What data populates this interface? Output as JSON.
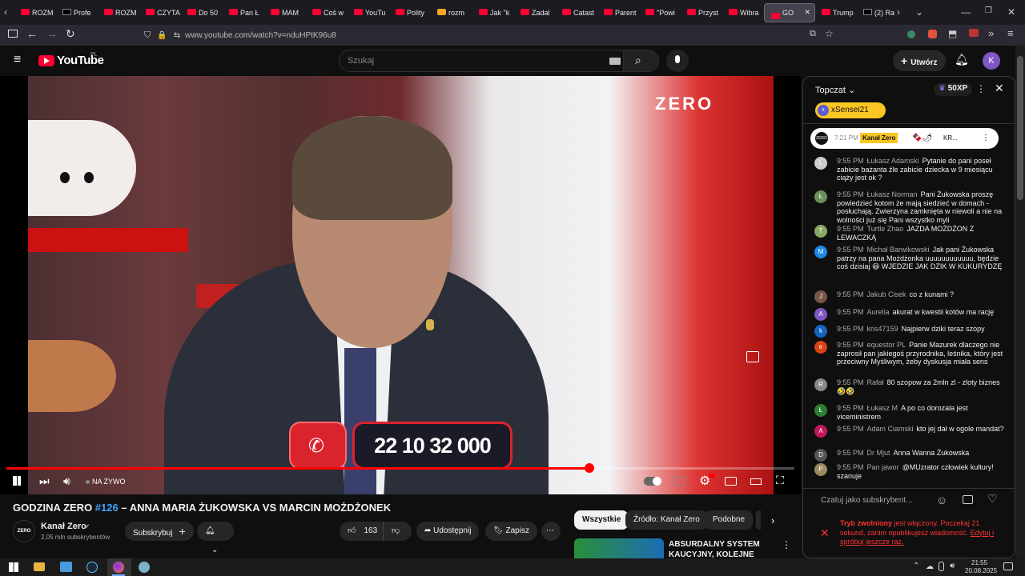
{
  "browser": {
    "tabs": [
      {
        "label": "ROZM",
        "fav": "yt"
      },
      {
        "label": "Profe",
        "fav": "x"
      },
      {
        "label": "ROZM",
        "fav": "yt"
      },
      {
        "label": "CZYTA",
        "fav": "yt"
      },
      {
        "label": "Do 50",
        "fav": "yt"
      },
      {
        "label": "Pan Ł",
        "fav": "yt"
      },
      {
        "label": "MAM",
        "fav": "yt"
      },
      {
        "label": "Coś w",
        "fav": "yt"
      },
      {
        "label": "YouTu",
        "fav": "yt"
      },
      {
        "label": "Polity",
        "fav": "yt"
      },
      {
        "label": "rozm",
        "fav": "jp"
      },
      {
        "label": "Jak \"k",
        "fav": "yt"
      },
      {
        "label": "Zadal",
        "fav": "yt"
      },
      {
        "label": "Catast",
        "fav": "yt"
      },
      {
        "label": "Parent",
        "fav": "yt"
      },
      {
        "label": "\"Powi",
        "fav": "yt"
      },
      {
        "label": "Przyst",
        "fav": "yt"
      },
      {
        "label": "Wibra",
        "fav": "yt"
      },
      {
        "label": "GO",
        "fav": "yt",
        "active": true
      },
      {
        "label": "Trump",
        "fav": "yt"
      },
      {
        "label": "(2) Ra",
        "fav": "x"
      }
    ],
    "url": "www.youtube.com/watch?v=nduHPtK96u8"
  },
  "youtube": {
    "logo": "YouTube",
    "region": "PL",
    "search_placeholder": "Szukaj",
    "create_label": "Utwórz",
    "avatar_letter": "K"
  },
  "video": {
    "live_label": "NA ŻYWO",
    "phone_number": "22 10 32 000",
    "channel_watermark": "ZERO",
    "progress_fraction": 0.74
  },
  "meta": {
    "title_prefix": "GODZINA ZERO ",
    "title_episode": "#126",
    "title_rest": " – ANNA MARIA ŻUKOWSKA VS MARCIN MOŻDŻONEK",
    "channel_name": "Kanał Zero",
    "subscribers": "2,05 mln subskrybentów",
    "subscribe_label": "Subskrybuj",
    "likes": "163",
    "share_label": "Udostępnij",
    "save_label": "Zapisz"
  },
  "chips": [
    "Wszystkie",
    "Źródło: Kanał Zero",
    "Podobne"
  ],
  "recommendation": {
    "title_line1": "ABSURDALNY SYSTEM",
    "title_line2": "KAUCYJNY, KOLEJNE"
  },
  "chat": {
    "header": "Topczat",
    "xp": "50XP",
    "pinned_user": "xSensei21",
    "pinned_msg_time": "7:21 PM",
    "pinned_msg_author": "Kanał Zero",
    "pinned_msg_text": "KR...",
    "input_placeholder": "Czatuj jako subskrybent...",
    "slow_mode_title": "Tryb zwolniony",
    "slow_mode_text": " jest włączony. Poczekaj 21 sekund, zanim opublikujesz wiadomość.",
    "slow_mode_link": "Edytuj i spróbuj jeszcze raz.",
    "messages": [
      {
        "time": "9:55 PM",
        "author": "Łukasz Adamski",
        "text": "Pytanie do pani poseł zabicie bażanta źle zabicie dziecka w 9 miesiącu ciąży jest ok ?",
        "av": "L",
        "color": "#ccc"
      },
      {
        "time": "9:55 PM",
        "author": "Łukasz Norman",
        "text": "Pani Żukowska proszę powiedzieć kotom że mają siedzieć w domach - posłuchają. Zwierzyna zamknięta w niewoli a nie na wolności już się Pani wszystko myli",
        "av": "Ł",
        "color": "#6b8f5a"
      },
      {
        "time": "9:55 PM",
        "author": "Turtle Zhao",
        "text": "JAZDA MOŻDŻON Z LEWACZKĄ",
        "av": "T",
        "color": "#8a6"
      },
      {
        "time": "9:55 PM",
        "author": "Michał Barwikowski",
        "text": "Jak pani Żukowska patrzy na pana Możdżonka uuuuuuuuuuuu, będzie coś dzisiaj 😆 WJEDZIE JAK DZIK W KUKURYDZĘ",
        "av": "M",
        "color": "#1e88e5"
      },
      {
        "time": "9:55 PM",
        "author": "Jakub Cisek",
        "text": "co z kunami ?",
        "av": "J",
        "color": "#795548"
      },
      {
        "time": "9:55 PM",
        "author": "Aurelia",
        "text": "akurat w kwestii kotów ma rację",
        "av": "A",
        "color": "#7e57c2"
      },
      {
        "time": "9:55 PM",
        "author": "kris47159",
        "text": "Najpierw dziki teraz szopy",
        "av": "k",
        "color": "#1565c0"
      },
      {
        "time": "9:55 PM",
        "author": "equestor PL",
        "text": "Panie Mazurek dlaczego nie zaprosił pan jakiegoś przyrodnika, leśnika, który jest przeciwny Myśliwym, żeby dyskusja miała sens",
        "av": "e",
        "color": "#d84315"
      },
      {
        "time": "9:55 PM",
        "author": "Rafał",
        "text": "80 szopow za 2mln zl - zloty biznes 🤣🤣",
        "av": "R",
        "color": "#888"
      },
      {
        "time": "9:55 PM",
        "author": "Łukasz M",
        "text": "A po co dorozala jest viceministrem",
        "av": "Ł",
        "color": "#2e7d32"
      },
      {
        "time": "9:55 PM",
        "author": "Adam Ciamski",
        "text": "kto jej dał w ogole mandat?",
        "av": "A",
        "color": "#c2185b"
      },
      {
        "time": "9:55 PM",
        "author": "Dr Mjut",
        "text": "Anna Wanna Żukowska",
        "av": "D",
        "color": "#555"
      },
      {
        "time": "9:55 PM",
        "author": "Pan jawor",
        "text": "@MUzrator człowiek kultury! szanuje",
        "av": "P",
        "color": "#9c8a60"
      }
    ]
  },
  "taskbar": {
    "time": "21:55",
    "date": "20.08.2025"
  }
}
